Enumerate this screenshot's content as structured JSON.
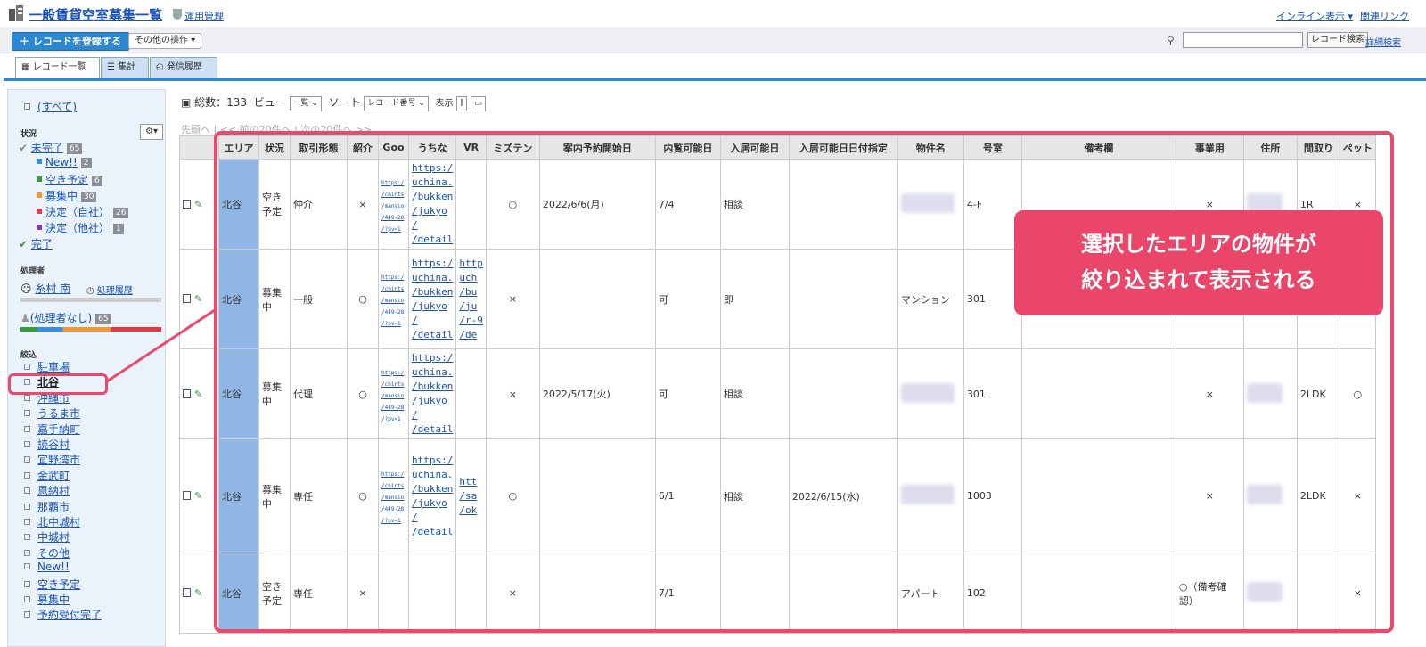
{
  "header": {
    "title": "一般賃貸空室募集一覧",
    "admin_link": "運用管理",
    "inline_link": "インライン表示 ▾",
    "related_link": "関連リンク"
  },
  "toolbar": {
    "register_label": "＋ レコードを登録する",
    "other_label": "その他の操作 ▾",
    "search_placeholder": "",
    "search_button": "レコード検索",
    "advanced_link": "詳細検索"
  },
  "tabs": [
    "レコード一覧",
    "集計",
    "発信履歴"
  ],
  "sidebar": {
    "all": "(すべて)",
    "status_head": "状況",
    "status_items": [
      {
        "label": "未完了",
        "count": "65"
      },
      {
        "label": "New!!",
        "count": "2",
        "color": "#3a8de0"
      },
      {
        "label": "空き予定",
        "count": "6",
        "color": "#3a9a3a"
      },
      {
        "label": "募集中",
        "count": "30",
        "color": "#f0963a"
      },
      {
        "label": "決定（自社）",
        "count": "26",
        "color": "#e03a4a"
      },
      {
        "label": "決定（他社）",
        "count": "1",
        "color": "#8a3ab0"
      },
      {
        "label": "完了",
        "count": ""
      }
    ],
    "handler_head": "処理者",
    "handler_name": "糸村 南",
    "handler_history": "処理履歴",
    "no_handler": "(処理者なし)",
    "no_handler_count": "65",
    "filter_head": "絞込",
    "filters": [
      "駐車場",
      "北谷",
      "沖縄市",
      "うるま市",
      "嘉手納町",
      "読谷村",
      "宜野湾市",
      "金武町",
      "恩納村",
      "那覇市",
      "北中城村",
      "中城村",
      "その他",
      "New!!",
      "空き予定",
      "募集中",
      "予約受付完了"
    ]
  },
  "main": {
    "total_label": "総数：133",
    "view_label": "ビュー",
    "view_value": "一覧",
    "sort_label": "ソート",
    "sort_value": "レコード番号",
    "display_label": "表示",
    "pager": "先頭へ | << 前の20件へ | 次の20件へ >>"
  },
  "table": {
    "columns": [
      "エリア",
      "状況",
      "取引形態",
      "紹介",
      "Goo",
      "うちな",
      "VR",
      "ミズテン",
      "案内予約開始日",
      "内覧可能日",
      "入居可能日",
      "入居可能日日付指定",
      "物件名",
      "号室",
      "備考欄",
      "事業用",
      "住所",
      "間取り",
      "ペット"
    ],
    "rows": [
      {
        "area": "北谷",
        "status": "空き予定",
        "deal": "仲介",
        "intro": "×",
        "goo": "https:/\n/chints\n/mansio\n/449-28\n/?pv=1",
        "uchina": "https:/\nuchina.\n/bukken\n/jukyo\n/\n/detail",
        "vr": "",
        "mizuten": "○",
        "tour": "2022/6/6(月)",
        "view": "7/4",
        "move": "相談",
        "move_date": "",
        "name": "",
        "room": "4-F",
        "remarks": "",
        "biz": "×",
        "addr": "",
        "layout": "1R",
        "pet": "×"
      },
      {
        "area": "北谷",
        "status": "募集中",
        "deal": "一般",
        "intro": "○",
        "goo": "https:/\n/chints\n/mansio\n/449-28\n/?pv=1",
        "uchina": "https:/\nuchina.\n/bukken\n/jukyo\n/\n/detail",
        "vr": "http\nuch\n/bu\n/ju\n/r-9\n/de",
        "mizuten": "×",
        "tour": "",
        "view": "可",
        "move": "即",
        "move_date": "",
        "name": "マンション",
        "room": "301",
        "remarks": "",
        "biz": "",
        "addr": "",
        "layout": "",
        "pet": ""
      },
      {
        "area": "北谷",
        "status": "募集中",
        "deal": "代理",
        "intro": "○",
        "goo": "https:/\n/chints\n/mansio\n/449-28\n/?pv=1",
        "uchina": "https:/\nuchina.\n/bukken\n/jukyo\n/\n/detail",
        "vr": "",
        "mizuten": "×",
        "tour": "2022/5/17(火)",
        "view": "可",
        "move": "相談",
        "move_date": "",
        "name": "",
        "room": "301",
        "remarks": "",
        "biz": "×",
        "addr": "",
        "layout": "2LDK",
        "pet": "○"
      },
      {
        "area": "北谷",
        "status": "募集中",
        "deal": "専任",
        "intro": "○",
        "goo": "https:/\n/chints\n/mansio\n/449-28\n/?pv=1",
        "uchina": "https:/\nuchina.\n/bukken\n/jukyo\n/\n/detail",
        "vr": "htt\n/sa\n/ok",
        "mizuten": "○",
        "tour": "",
        "view": "6/1",
        "move": "相談",
        "move_date": "2022/6/15(水)",
        "name": "",
        "room": "1003",
        "remarks": "",
        "biz": "×",
        "addr": "",
        "layout": "2LDK",
        "pet": "×"
      },
      {
        "area": "北谷",
        "status": "空き予定",
        "deal": "専任",
        "intro": "×",
        "goo": "",
        "uchina": "",
        "vr": "",
        "mizuten": "×",
        "tour": "",
        "view": "7/1",
        "move": "",
        "move_date": "",
        "name": "アパート",
        "room": "102",
        "remarks": "",
        "biz": "○（備考確認）",
        "addr": "",
        "layout": "",
        "pet": "×"
      }
    ]
  },
  "callout": {
    "line1": "選択したエリアの物件が",
    "line2": "絞り込まれて表示される"
  }
}
